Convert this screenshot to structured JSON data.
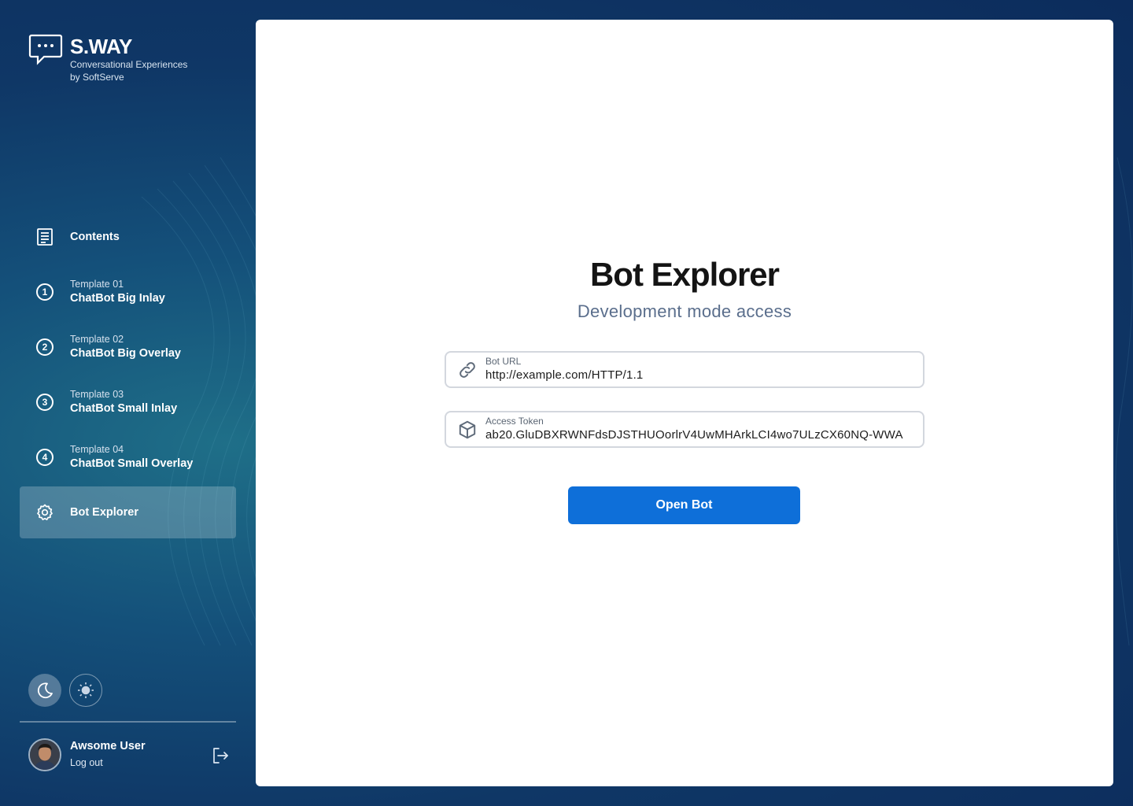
{
  "brand": {
    "name": "S.WAY",
    "tagline_line1": "Conversational Experiences",
    "tagline_line2": "by SoftServe"
  },
  "sidebar": {
    "items": [
      {
        "label": "Contents",
        "icon": "list-document-icon"
      },
      {
        "sub": "Template 01",
        "label": "ChatBot Big Inlay",
        "number": "1"
      },
      {
        "sub": "Template 02",
        "label": "ChatBot Big Overlay",
        "number": "2"
      },
      {
        "sub": "Template 03",
        "label": "ChatBot Small Inlay",
        "number": "3"
      },
      {
        "sub": "Template 04",
        "label": "ChatBot Small Overlay",
        "number": "4"
      },
      {
        "label": "Bot Explorer",
        "icon": "gear-icon",
        "active": true
      }
    ],
    "theme": {
      "selected": "dark"
    }
  },
  "user": {
    "name": "Awsome User",
    "logout_label": "Log out"
  },
  "main": {
    "title": "Bot Explorer",
    "subtitle": "Development mode access",
    "bot_url": {
      "label": "Bot URL",
      "value": "http://example.com/HTTP/1.1"
    },
    "access_token": {
      "label": "Access Token",
      "value": "ab20.GluDBXRWNFdsDJSTHUOorlrV4UwMHArkLCI4wo7ULzCX60NQ-WWA"
    },
    "open_button": "Open Bot"
  },
  "colors": {
    "accent": "#0e6fd9",
    "sidebar_bg": "#0f3766",
    "active_item_bg": "rgba(255,255,255,0.22)"
  }
}
